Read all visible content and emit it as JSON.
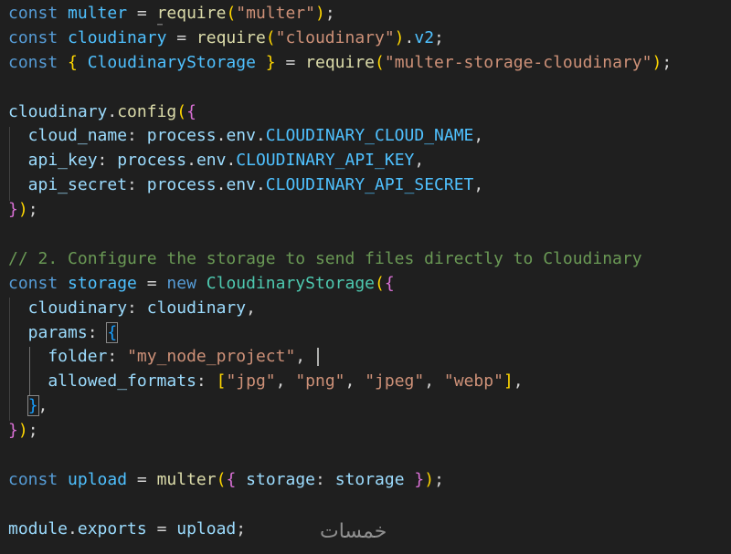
{
  "editor": {
    "lines": [
      [
        {
          "t": "const",
          "c": "kw"
        },
        {
          "t": " ",
          "c": "op"
        },
        {
          "t": "multer",
          "c": "var"
        },
        {
          "t": " = ",
          "c": "op"
        },
        {
          "t": "require",
          "c": "fn"
        },
        {
          "t": "(",
          "c": "b1"
        },
        {
          "t": "\"multer\"",
          "c": "str"
        },
        {
          "t": ")",
          "c": "b1"
        },
        {
          "t": ";",
          "c": "punc"
        }
      ],
      [
        {
          "t": "const",
          "c": "kw"
        },
        {
          "t": " ",
          "c": "op"
        },
        {
          "t": "cloudinary",
          "c": "var"
        },
        {
          "t": " = ",
          "c": "op"
        },
        {
          "t": "require",
          "c": "fn"
        },
        {
          "t": "(",
          "c": "b1"
        },
        {
          "t": "\"cloudinary\"",
          "c": "str"
        },
        {
          "t": ")",
          "c": "b1"
        },
        {
          "t": ".",
          "c": "punc"
        },
        {
          "t": "v2",
          "c": "var"
        },
        {
          "t": ";",
          "c": "punc"
        }
      ],
      [
        {
          "t": "const",
          "c": "kw"
        },
        {
          "t": " ",
          "c": "op"
        },
        {
          "t": "{",
          "c": "b1"
        },
        {
          "t": " ",
          "c": "op"
        },
        {
          "t": "CloudinaryStorage",
          "c": "var"
        },
        {
          "t": " ",
          "c": "op"
        },
        {
          "t": "}",
          "c": "b1"
        },
        {
          "t": " = ",
          "c": "op"
        },
        {
          "t": "require",
          "c": "fn"
        },
        {
          "t": "(",
          "c": "b1"
        },
        {
          "t": "\"multer-storage-cloudinary\"",
          "c": "str"
        },
        {
          "t": ")",
          "c": "b1"
        },
        {
          "t": ";",
          "c": "punc"
        }
      ],
      [],
      [
        {
          "t": "cloudinary",
          "c": "var2"
        },
        {
          "t": ".",
          "c": "punc"
        },
        {
          "t": "config",
          "c": "fn"
        },
        {
          "t": "(",
          "c": "b1"
        },
        {
          "t": "{",
          "c": "b2"
        }
      ],
      [
        {
          "t": "  cloud_name",
          "c": "var2"
        },
        {
          "t": ": ",
          "c": "punc"
        },
        {
          "t": "process",
          "c": "var2"
        },
        {
          "t": ".",
          "c": "punc"
        },
        {
          "t": "env",
          "c": "var2"
        },
        {
          "t": ".",
          "c": "punc"
        },
        {
          "t": "CLOUDINARY_CLOUD_NAME",
          "c": "const"
        },
        {
          "t": ",",
          "c": "punc"
        }
      ],
      [
        {
          "t": "  api_key",
          "c": "var2"
        },
        {
          "t": ": ",
          "c": "punc"
        },
        {
          "t": "process",
          "c": "var2"
        },
        {
          "t": ".",
          "c": "punc"
        },
        {
          "t": "env",
          "c": "var2"
        },
        {
          "t": ".",
          "c": "punc"
        },
        {
          "t": "CLOUDINARY_API_KEY",
          "c": "const"
        },
        {
          "t": ",",
          "c": "punc"
        }
      ],
      [
        {
          "t": "  api_secret",
          "c": "var2"
        },
        {
          "t": ": ",
          "c": "punc"
        },
        {
          "t": "process",
          "c": "var2"
        },
        {
          "t": ".",
          "c": "punc"
        },
        {
          "t": "env",
          "c": "var2"
        },
        {
          "t": ".",
          "c": "punc"
        },
        {
          "t": "CLOUDINARY_API_SECRET",
          "c": "const"
        },
        {
          "t": ",",
          "c": "punc"
        }
      ],
      [
        {
          "t": "}",
          "c": "b2"
        },
        {
          "t": ")",
          "c": "b1"
        },
        {
          "t": ";",
          "c": "punc"
        }
      ],
      [],
      [
        {
          "t": "// 2. Configure the storage to send files directly to Cloudinary",
          "c": "com"
        }
      ],
      [
        {
          "t": "const",
          "c": "kw"
        },
        {
          "t": " ",
          "c": "op"
        },
        {
          "t": "storage",
          "c": "var"
        },
        {
          "t": " = ",
          "c": "op"
        },
        {
          "t": "new",
          "c": "kw"
        },
        {
          "t": " ",
          "c": "op"
        },
        {
          "t": "CloudinaryStorage",
          "c": "cls"
        },
        {
          "t": "(",
          "c": "b1"
        },
        {
          "t": "{",
          "c": "b2"
        }
      ],
      [
        {
          "t": "  cloudinary",
          "c": "var2"
        },
        {
          "t": ": ",
          "c": "punc"
        },
        {
          "t": "cloudinary",
          "c": "var2"
        },
        {
          "t": ",",
          "c": "punc"
        }
      ],
      [
        {
          "t": "  params",
          "c": "var2"
        },
        {
          "t": ": ",
          "c": "punc"
        },
        {
          "t": "{",
          "c": "b3",
          "box": true
        }
      ],
      [
        {
          "t": "    folder",
          "c": "var2"
        },
        {
          "t": ": ",
          "c": "punc"
        },
        {
          "t": "\"my_node_project\"",
          "c": "str"
        },
        {
          "t": ", ",
          "c": "punc"
        },
        {
          "cursor": true
        }
      ],
      [
        {
          "t": "    allowed_formats",
          "c": "var2"
        },
        {
          "t": ": ",
          "c": "punc"
        },
        {
          "t": "[",
          "c": "b1"
        },
        {
          "t": "\"jpg\"",
          "c": "str"
        },
        {
          "t": ", ",
          "c": "punc"
        },
        {
          "t": "\"png\"",
          "c": "str"
        },
        {
          "t": ", ",
          "c": "punc"
        },
        {
          "t": "\"jpeg\"",
          "c": "str"
        },
        {
          "t": ", ",
          "c": "punc"
        },
        {
          "t": "\"webp\"",
          "c": "str"
        },
        {
          "t": "]",
          "c": "b1"
        },
        {
          "t": ",",
          "c": "punc"
        }
      ],
      [
        {
          "t": "  ",
          "c": "op"
        },
        {
          "t": "}",
          "c": "b3",
          "box": true
        },
        {
          "t": ",",
          "c": "punc"
        }
      ],
      [
        {
          "t": "}",
          "c": "b2"
        },
        {
          "t": ")",
          "c": "b1"
        },
        {
          "t": ";",
          "c": "punc"
        }
      ],
      [],
      [
        {
          "t": "const",
          "c": "kw"
        },
        {
          "t": " ",
          "c": "op"
        },
        {
          "t": "upload",
          "c": "var"
        },
        {
          "t": " = ",
          "c": "op"
        },
        {
          "t": "multer",
          "c": "fn"
        },
        {
          "t": "(",
          "c": "b1"
        },
        {
          "t": "{",
          "c": "b2"
        },
        {
          "t": " ",
          "c": "op"
        },
        {
          "t": "storage",
          "c": "var2"
        },
        {
          "t": ": ",
          "c": "punc"
        },
        {
          "t": "storage",
          "c": "var2"
        },
        {
          "t": " ",
          "c": "op"
        },
        {
          "t": "}",
          "c": "b2"
        },
        {
          "t": ")",
          "c": "b1"
        },
        {
          "t": ";",
          "c": "punc"
        }
      ],
      [],
      [
        {
          "t": "module",
          "c": "var2"
        },
        {
          "t": ".",
          "c": "punc"
        },
        {
          "t": "exports",
          "c": "var2"
        },
        {
          "t": " = ",
          "c": "op"
        },
        {
          "t": "upload",
          "c": "var2"
        },
        {
          "t": ";",
          "c": "punc"
        }
      ]
    ]
  },
  "watermark": "خمسات",
  "colors": {
    "background": "#1f1f1f",
    "keyword": "#569cd6",
    "variable": "#4fc1ff",
    "property": "#9cdcfe",
    "function": "#dcdcaa",
    "string": "#ce9178",
    "class": "#4ec9b0",
    "comment": "#6a9955",
    "bracket_level1": "#ffd700",
    "bracket_level2": "#da70d6",
    "bracket_level3": "#179fff"
  }
}
